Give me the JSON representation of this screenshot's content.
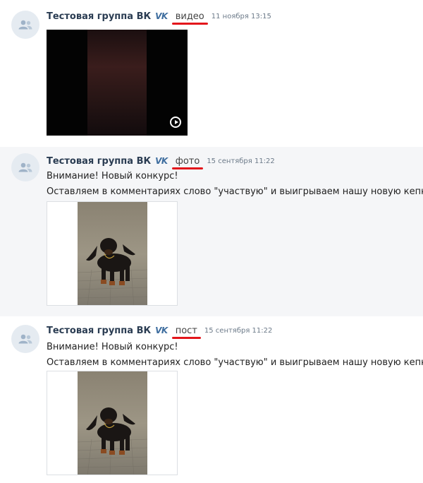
{
  "posts": [
    {
      "author": "Тестовая группа ВК",
      "badge": "VK",
      "type": "видео",
      "time": "11 ноября 13:15",
      "media": "video",
      "icons": [
        "users-icon",
        "play-icon"
      ]
    },
    {
      "author": "Тестовая группа ВК",
      "badge": "VK",
      "type": "фото",
      "time": "15 сентября 11:22",
      "text_line1": "Внимание! Новый конкурс!",
      "text_line2": "Оставляем в комментариях слово \"участвую\" и выигрываем нашу новую кепку!",
      "media": "photo"
    },
    {
      "author": "Тестовая группа ВК",
      "badge": "VK",
      "type": "пост",
      "time": "15 сентября 11:22",
      "text_line1": "Внимание! Новый конкурс!",
      "text_line2": "Оставляем в комментариях слово \"участвую\" и выигрываем нашу новую кепку!",
      "media": "photo"
    }
  ],
  "colors": {
    "author": "#2a3c52",
    "underline": "#e3161b",
    "highlight_bg": "#f5f6f8",
    "avatar_bg": "#e5ebf1"
  }
}
